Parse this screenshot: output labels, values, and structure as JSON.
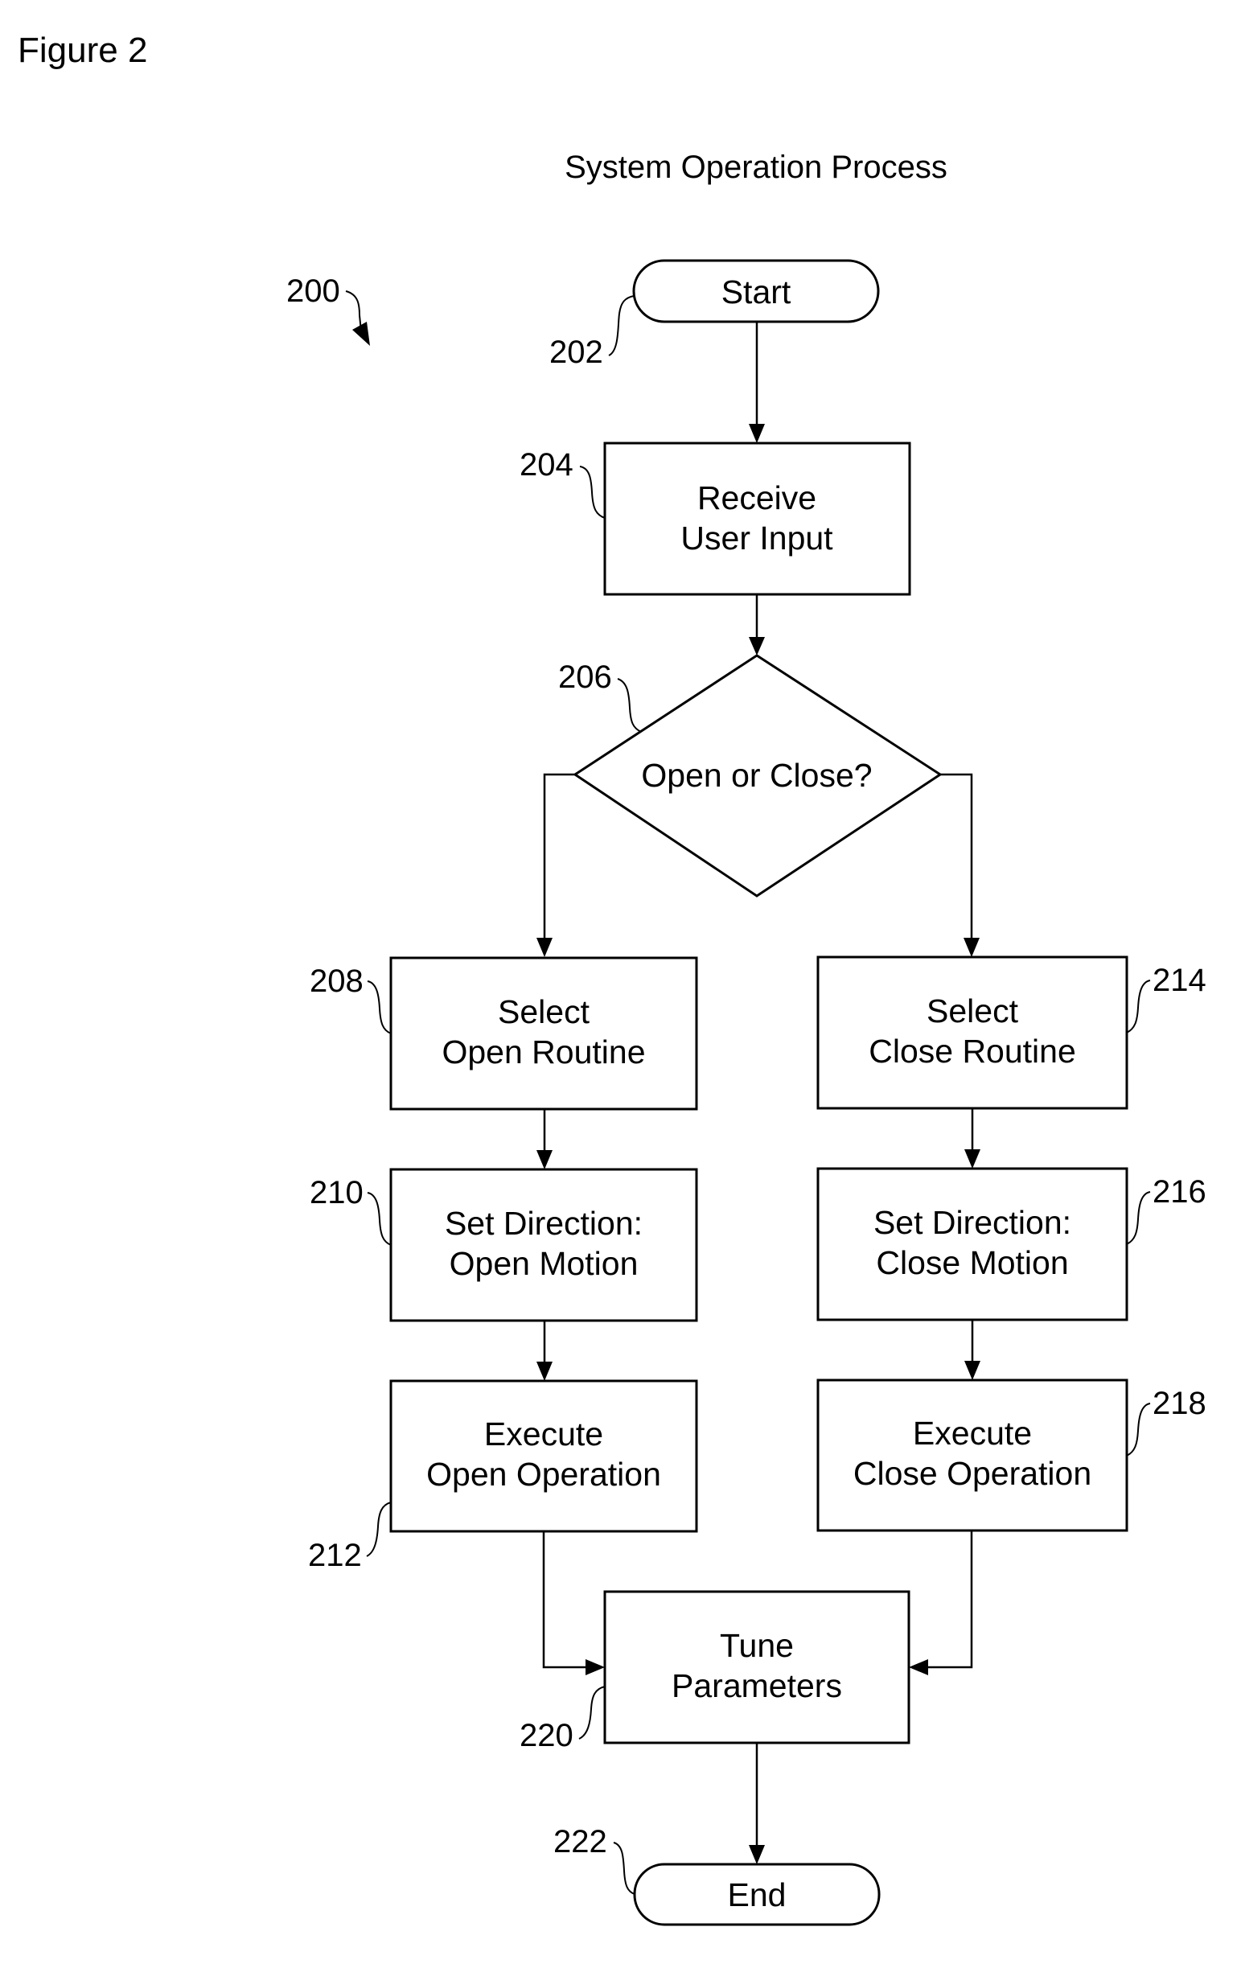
{
  "figure_label": "Figure 2",
  "title": "System Operation Process",
  "process_ref": "200",
  "nodes": {
    "start": {
      "ref": "202",
      "type": "terminator",
      "lines": [
        "Start"
      ]
    },
    "receive_input": {
      "ref": "204",
      "type": "process",
      "lines": [
        "Receive",
        "User Input"
      ]
    },
    "decision": {
      "ref": "206",
      "type": "decision",
      "lines": [
        "Open or Close?"
      ]
    },
    "select_open": {
      "ref": "208",
      "type": "process",
      "lines": [
        "Select",
        "Open Routine"
      ]
    },
    "set_open": {
      "ref": "210",
      "type": "process",
      "lines": [
        "Set Direction:",
        "Open Motion"
      ]
    },
    "exec_open": {
      "ref": "212",
      "type": "process",
      "lines": [
        "Execute",
        "Open Operation"
      ]
    },
    "select_close": {
      "ref": "214",
      "type": "process",
      "lines": [
        "Select",
        "Close Routine"
      ]
    },
    "set_close": {
      "ref": "216",
      "type": "process",
      "lines": [
        "Set Direction:",
        "Close Motion"
      ]
    },
    "exec_close": {
      "ref": "218",
      "type": "process",
      "lines": [
        "Execute",
        "Close Operation"
      ]
    },
    "tune": {
      "ref": "220",
      "type": "process",
      "lines": [
        "Tune",
        "Parameters"
      ]
    },
    "end": {
      "ref": "222",
      "type": "terminator",
      "lines": [
        "End"
      ]
    }
  },
  "edges": [
    {
      "from": "start",
      "to": "receive_input"
    },
    {
      "from": "receive_input",
      "to": "decision"
    },
    {
      "from": "decision",
      "to": "select_open",
      "branch": "open"
    },
    {
      "from": "decision",
      "to": "select_close",
      "branch": "close"
    },
    {
      "from": "select_open",
      "to": "set_open"
    },
    {
      "from": "set_open",
      "to": "exec_open"
    },
    {
      "from": "exec_open",
      "to": "tune"
    },
    {
      "from": "select_close",
      "to": "set_close"
    },
    {
      "from": "set_close",
      "to": "exec_close"
    },
    {
      "from": "exec_close",
      "to": "tune"
    },
    {
      "from": "tune",
      "to": "end"
    }
  ]
}
